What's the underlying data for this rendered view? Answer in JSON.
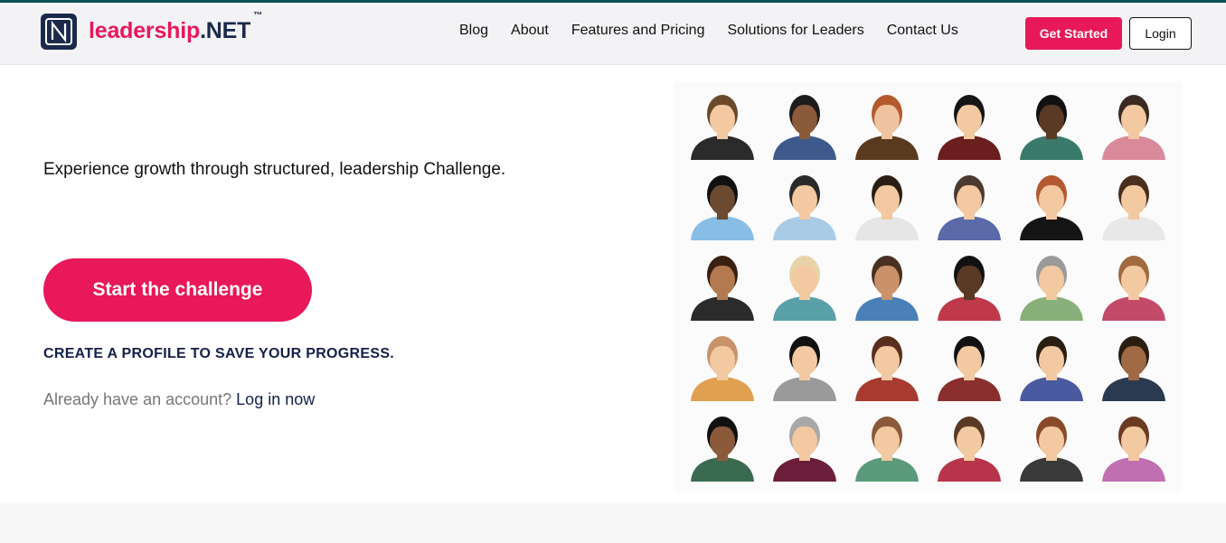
{
  "header": {
    "logo": {
      "brand_primary": "leadership",
      "brand_suffix": ".NET",
      "trademark": "™",
      "mark_letter": "N"
    },
    "nav": [
      "Blog",
      "About",
      "Features and Pricing",
      "Solutions for Leaders",
      "Contact Us"
    ],
    "get_started_label": "Get Started",
    "login_label": "Login"
  },
  "hero": {
    "tagline": "Experience growth through structured, leadership Challenge.",
    "cta_label": "Start the challenge",
    "profile_note": "CREATE A PROFILE TO SAVE YOUR PROGRESS.",
    "account_prompt": "Already have an account?",
    "login_link": "Log in now"
  },
  "colors": {
    "accent": "#e8185a",
    "brand_navy": "#1b2a4a",
    "header_bar": "#0e4f57"
  },
  "avatars": [
    [
      "#6b4a2c",
      "#f2c9a0",
      "#2b2b2b"
    ],
    [
      "#1c1c1c",
      "#8a5a3b",
      "#3e5a8c"
    ],
    [
      "#b35a2c",
      "#f0c3a0",
      "#5a3a1e"
    ],
    [
      "#151515",
      "#f2c9a0",
      "#6b1e1e"
    ],
    [
      "#111111",
      "#5a3a24",
      "#3a7a6a"
    ],
    [
      "#3a2a22",
      "#f2c9a0",
      "#d88a9a"
    ],
    [
      "#111111",
      "#6b4a30",
      "#88bde6"
    ],
    [
      "#2a2a2a",
      "#f2c9a0",
      "#a9cbe6"
    ],
    [
      "#2a1e12",
      "#f2c9a0",
      "#e6e6e6"
    ],
    [
      "#4a3a30",
      "#f2c9a0",
      "#5a6aa8"
    ],
    [
      "#b55a30",
      "#f2c9a0",
      "#151515"
    ],
    [
      "#4a2e1e",
      "#f2c9a0",
      "#e8e8e8"
    ],
    [
      "#3a2012",
      "#b37a50",
      "#2b2b2b"
    ],
    [
      "#e8d3a8",
      "#f2c9a0",
      "#5aa0a8"
    ],
    [
      "#4a3020",
      "#c9926a",
      "#4a80b8"
    ],
    [
      "#111111",
      "#5a3a24",
      "#c0394a"
    ],
    [
      "#9a9a9a",
      "#f2c9a0",
      "#88b07a"
    ],
    [
      "#a06a40",
      "#f2c9a0",
      "#c44a6a"
    ],
    [
      "#c9926a",
      "#f2c9a0",
      "#e0a050"
    ],
    [
      "#111111",
      "#f2c9a0",
      "#9a9a9a"
    ],
    [
      "#5a2e1e",
      "#f2c9a0",
      "#a83a30"
    ],
    [
      "#111111",
      "#f2c9a0",
      "#8a2e2e"
    ],
    [
      "#2a1e12",
      "#f2c9a0",
      "#4a5aa0"
    ],
    [
      "#2a1e12",
      "#a06a44",
      "#2a3a50"
    ],
    [
      "#111111",
      "#8a5a3b",
      "#3a6a50"
    ],
    [
      "#a8a8a8",
      "#f2c9a0",
      "#6a1e3a"
    ],
    [
      "#8a5a3b",
      "#f2c9a0",
      "#5a9a7a"
    ],
    [
      "#5a3a24",
      "#f2c9a0",
      "#b8344a"
    ],
    [
      "#8a4a2a",
      "#f2c9a0",
      "#3a3a3a"
    ],
    [
      "#6a3a22",
      "#f2c9a0",
      "#c070b0"
    ]
  ]
}
